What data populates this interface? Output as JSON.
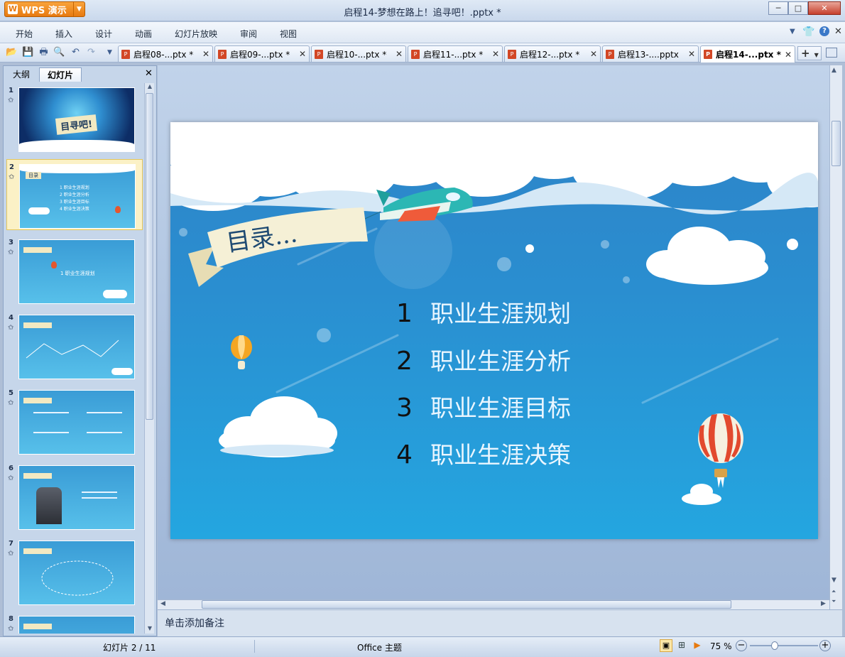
{
  "window": {
    "app_button": "WPS 演示",
    "title": "启程14-梦想在路上！追寻吧！.pptx *"
  },
  "menu": [
    "开始",
    "插入",
    "设计",
    "动画",
    "幻灯片放映",
    "审阅",
    "视图"
  ],
  "doc_tabs": [
    {
      "label": "启程08-...ptx *",
      "active": false
    },
    {
      "label": "启程09-...ptx *",
      "active": false
    },
    {
      "label": "启程10-...ptx *",
      "active": false
    },
    {
      "label": "启程11-...ptx *",
      "active": false
    },
    {
      "label": "启程12-...ptx *",
      "active": false
    },
    {
      "label": "启程13-....pptx",
      "active": false
    },
    {
      "label": "启程14-...ptx *",
      "active": true
    }
  ],
  "panel": {
    "tabs": [
      "大纲",
      "幻灯片"
    ],
    "active_tab": "幻灯片"
  },
  "thumbnails": [
    {
      "num": "1",
      "text": [
        "目寻吧!"
      ]
    },
    {
      "num": "2",
      "text": [
        "目录",
        "1 职业生涯规划",
        "2 职业生涯分析",
        "3 职业生涯目标",
        "4 职业生涯决策"
      ]
    },
    {
      "num": "3",
      "text": [
        "1 职业生涯规划"
      ]
    },
    {
      "num": "4",
      "text": []
    },
    {
      "num": "5",
      "text": []
    },
    {
      "num": "6",
      "text": []
    },
    {
      "num": "7",
      "text": []
    },
    {
      "num": "8",
      "text": []
    }
  ],
  "selected_thumbnail": "2",
  "slide": {
    "banner": "目录...",
    "items": [
      {
        "num": "1",
        "label": "职业生涯规划"
      },
      {
        "num": "2",
        "label": "职业生涯分析"
      },
      {
        "num": "3",
        "label": "职业生涯目标"
      },
      {
        "num": "4",
        "label": "职业生涯决策"
      }
    ]
  },
  "notes_placeholder": "单击添加备注",
  "status": {
    "slide_counter": "幻灯片 2 / 11",
    "theme": "Office 主题",
    "zoom": "75 %"
  }
}
